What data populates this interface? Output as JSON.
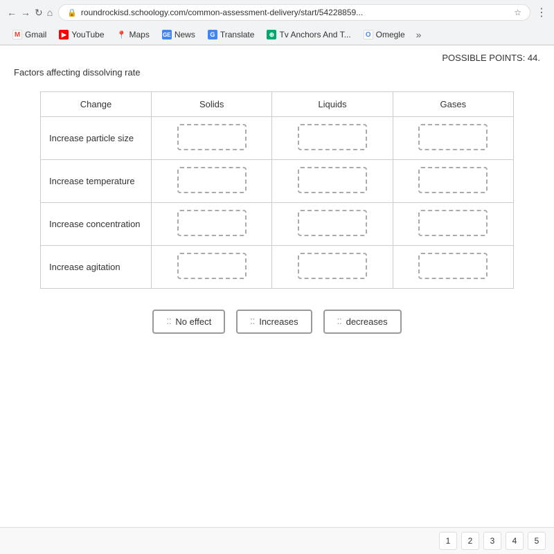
{
  "browser": {
    "url": "roundrockisd.schoology.com/common-assessment-delivery/start/54228859...",
    "nav": {
      "reload": "↻",
      "home": "⌂"
    }
  },
  "bookmarks": [
    {
      "id": "gmail",
      "label": "Gmail",
      "icon": "M",
      "color": "#EA4335"
    },
    {
      "id": "youtube",
      "label": "YouTube",
      "icon": "▶",
      "color": "#FF0000"
    },
    {
      "id": "maps",
      "label": "Maps",
      "icon": "📍",
      "color": "#4285F4"
    },
    {
      "id": "news",
      "label": "News",
      "icon": "GE",
      "color": "#4285F4"
    },
    {
      "id": "translate",
      "label": "Translate",
      "icon": "G",
      "color": "#4285F4"
    },
    {
      "id": "tv-anchors",
      "label": "Tv Anchors And T...",
      "icon": "⊕",
      "color": "#00A86B"
    },
    {
      "id": "omegle",
      "label": "Omegle",
      "icon": "O",
      "color": "#999"
    }
  ],
  "page": {
    "possible_points_label": "POSSIBLE POINTS: 44.",
    "question_title": "Factors affecting dissolving rate"
  },
  "table": {
    "headers": [
      "Change",
      "Solids",
      "Liquids",
      "Gases"
    ],
    "rows": [
      {
        "label": "Increase particle size"
      },
      {
        "label": "Increase temperature"
      },
      {
        "label": "Increase concentration"
      },
      {
        "label": "Increase agitation"
      }
    ]
  },
  "drag_items": [
    {
      "id": "no-effect",
      "label": "No effect",
      "handle": "⁚⁚"
    },
    {
      "id": "increases",
      "label": "Increases",
      "handle": "⁚⁚"
    },
    {
      "id": "decreases",
      "label": "decreases",
      "handle": "⁚⁚"
    }
  ],
  "pagination": {
    "pages": [
      "1",
      "2",
      "3",
      "4",
      "5"
    ]
  }
}
